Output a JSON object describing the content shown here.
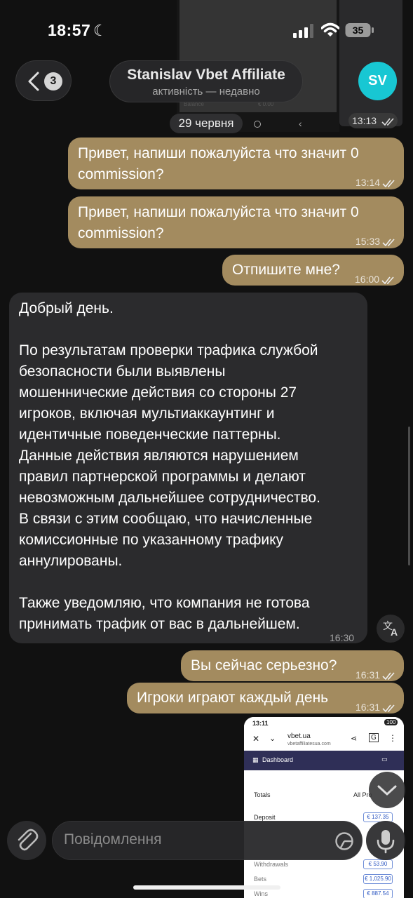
{
  "status_bar": {
    "time": "18:57",
    "battery": "35"
  },
  "background_screenshot": {
    "label": "Balance",
    "value": "€ 0.00"
  },
  "header": {
    "unread_count": "3",
    "chat_name": "Stanislav Vbet Affiliate",
    "chat_status": "активність — недавно",
    "avatar_initials": "SV",
    "avatar_color": "#18c7d3",
    "avatar_time": "13:13"
  },
  "date_separator": "29 червня",
  "messages": [
    {
      "direction": "out",
      "text": "Привет, напиши пожалуйста что значит 0 commission?",
      "time": "13:14",
      "read": true
    },
    {
      "direction": "out",
      "text": "Привет, напиши пожалуйста что значит 0 commission?",
      "time": "15:33",
      "read": true
    },
    {
      "direction": "out",
      "text": "Отпишите мне?",
      "time": "16:00",
      "read": true
    },
    {
      "direction": "in",
      "text_lines": [
        "Добрый день.",
        "",
        "По результатам проверки трафика службой",
        "безопасности были выявлены",
        "мошеннические действия со стороны 27",
        "игроков, включая мультиаккаунтинг и",
        "идентичные поведенческие паттерны.",
        "Данные действия являются нарушением",
        "правил партнерской программы и делают",
        "невозможным дальнейшее сотрудничество.",
        "В связи с этим сообщаю, что начисленные",
        "комиссионные по указанному трафику",
        "аннулированы.",
        "",
        "Также уведомляю, что компания не готова",
        "принимать трафик от вас в дальнейшем."
      ],
      "time": "16:30"
    },
    {
      "direction": "out",
      "text": "Вы сейчас серьезно?",
      "time": "16:31",
      "read": true
    },
    {
      "direction": "out",
      "text": "Игроки играют каждый день",
      "time": "16:31",
      "read": true
    }
  ],
  "media_preview": {
    "time": "13:11",
    "battery": "100",
    "site": "vbet.ua",
    "site_sub": "vbetaffiliatesua.com",
    "nav_label": "Dashboard",
    "section_totals": "Totals",
    "section_all": "All Pro",
    "rows": [
      {
        "label": "Deposit",
        "value": "€ 137.35"
      },
      {
        "label": "Withdrawals",
        "value": "€ 53.90"
      },
      {
        "label": "Bets",
        "value": "€ 1,025.90"
      },
      {
        "label": "Wins",
        "value": "€ 887.54"
      }
    ]
  },
  "composer": {
    "placeholder": "Повідомлення"
  },
  "colors": {
    "outgoing_bubble": "#a38b5f",
    "incoming_bubble": "#2b2b2d",
    "background": "#111111"
  }
}
